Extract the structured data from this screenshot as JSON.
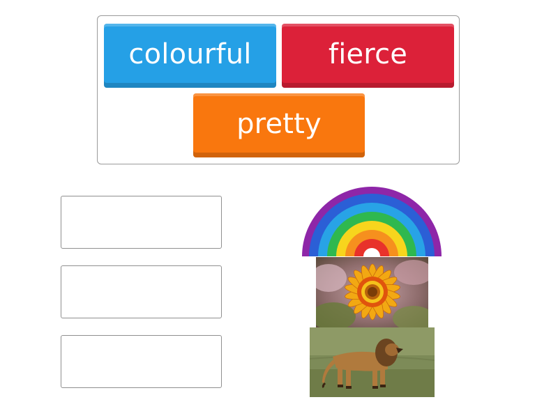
{
  "word_bank": {
    "tiles": [
      {
        "label": "colourful",
        "color": "#25a0e6"
      },
      {
        "label": "fierce",
        "color": "#dc2139"
      },
      {
        "label": "pretty",
        "color": "#f9770e"
      }
    ]
  },
  "drop_slots": [
    {
      "value": ""
    },
    {
      "value": ""
    },
    {
      "value": ""
    }
  ],
  "pictures": [
    {
      "icon": "rainbow-image"
    },
    {
      "icon": "flower-image"
    },
    {
      "icon": "lion-image"
    }
  ],
  "colors": {
    "rainbow": [
      "#8e26a8",
      "#2b5fd6",
      "#28a3e6",
      "#2fb84f",
      "#f7d51d",
      "#f6901e",
      "#e8322b"
    ]
  }
}
